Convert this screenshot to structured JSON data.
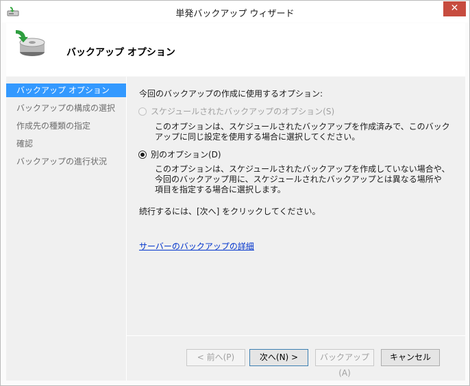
{
  "window": {
    "title": "単発バックアップ ウィザード",
    "close_label": "✕"
  },
  "header": {
    "title": "バックアップ オプション"
  },
  "nav": {
    "items": [
      {
        "label": "バックアップ オプション",
        "active": true
      },
      {
        "label": "バックアップの構成の選択",
        "active": false
      },
      {
        "label": "作成先の種類の指定",
        "active": false
      },
      {
        "label": "確認",
        "active": false
      },
      {
        "label": "バックアップの進行状況",
        "active": false
      }
    ]
  },
  "content": {
    "prompt": "今回のバックアップの作成に使用するオプション:",
    "option_scheduled": {
      "label": "スケジュールされたバックアップのオプション(S)",
      "selected": false,
      "enabled": false,
      "desc_line1": "このオプションは、スケジュールされたバックアップを作成済みで、このバック",
      "desc_line2": "アップに同じ設定を使用する場合に選択してください。"
    },
    "option_different": {
      "label": "別のオプション(D)",
      "selected": true,
      "enabled": true,
      "desc_line1": "このオプションは、スケジュールされたバックアップを作成していない場合や、",
      "desc_line2": "今回のバックアップ用に、スケジュールされたバックアップとは異なる場所や",
      "desc_line3": "項目を指定する場合に選択します。"
    },
    "continue_text": "続行するには、[次へ] をクリックしてください。",
    "details_link": "サーバーのバックアップの詳細"
  },
  "buttons": {
    "prev": "< 前へ(P)",
    "next": "次へ(N) >",
    "backup": "バックアップ(A)",
    "cancel": "キャンセル"
  },
  "colors": {
    "selection": "#3399ff",
    "close_button": "#c74c3f",
    "link": "#0033cc"
  },
  "icons": {
    "app": "backup-app-icon",
    "header": "backup-drive-icon"
  }
}
